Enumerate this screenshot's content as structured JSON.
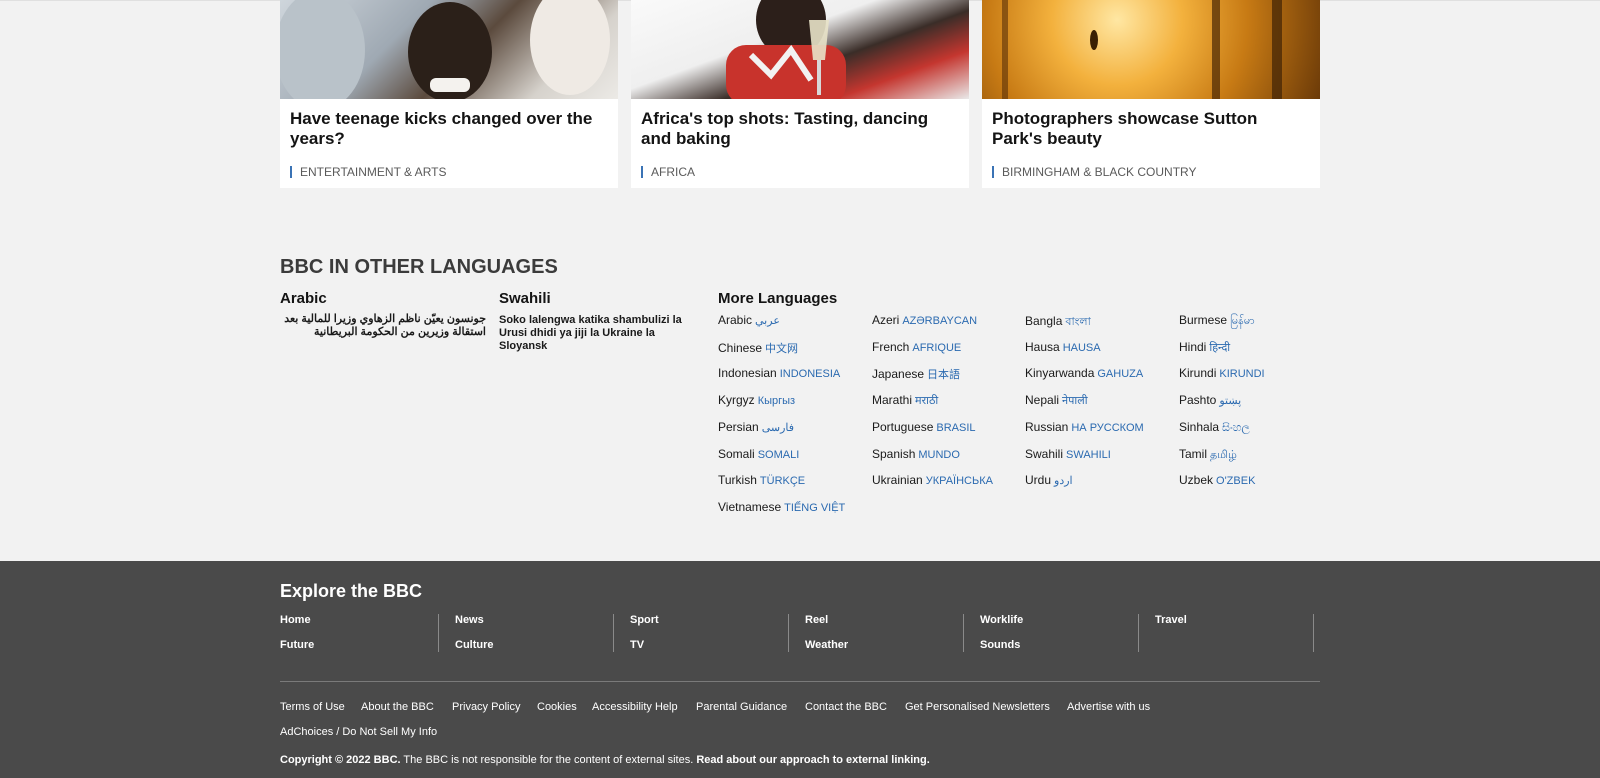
{
  "cards": [
    {
      "headline": "Have teenage kicks changed over the years?",
      "tag": "ENTERTAINMENT & ARTS"
    },
    {
      "headline": "Africa's top shots: Tasting, dancing and baking",
      "tag": "AFRICA"
    },
    {
      "headline": "Photographers showcase Sutton Park's beauty",
      "tag": "BIRMINGHAM & BLACK COUNTRY"
    }
  ],
  "languages": {
    "title": "BBC IN OTHER LANGUAGES",
    "arabic": {
      "heading": "Arabic",
      "story": "جونسون يعيّن ناظم الزهاوي وزيرا للمالية بعد استقالة وزيرين من الحكومة البريطانية"
    },
    "swahili": {
      "heading": "Swahili",
      "story": "Soko lalengwa katika shambulizi la Urusi dhidi ya jiji la Ukraine la Sloyansk"
    },
    "more_heading": "More Languages",
    "items": [
      {
        "name": "Arabic",
        "native": "عربي"
      },
      {
        "name": "Azeri",
        "native": "AZƏRBAYCAN"
      },
      {
        "name": "Bangla",
        "native": "বাংলা"
      },
      {
        "name": "Burmese",
        "native": "မြန်မာ"
      },
      {
        "name": "Chinese",
        "native": "中文网"
      },
      {
        "name": "French",
        "native": "AFRIQUE"
      },
      {
        "name": "Hausa",
        "native": "HAUSA"
      },
      {
        "name": "Hindi",
        "native": "हिन्दी"
      },
      {
        "name": "Indonesian",
        "native": "INDONESIA"
      },
      {
        "name": "Japanese",
        "native": "日本語"
      },
      {
        "name": "Kinyarwanda",
        "native": "GAHUZA"
      },
      {
        "name": "Kirundi",
        "native": "KIRUNDI"
      },
      {
        "name": "Kyrgyz",
        "native": "Кыргыз"
      },
      {
        "name": "Marathi",
        "native": "मराठी"
      },
      {
        "name": "Nepali",
        "native": "नेपाली"
      },
      {
        "name": "Pashto",
        "native": "پښتو"
      },
      {
        "name": "Persian",
        "native": "فارسی"
      },
      {
        "name": "Portuguese",
        "native": "BRASIL"
      },
      {
        "name": "Russian",
        "native": "НА РУССКОМ"
      },
      {
        "name": "Sinhala",
        "native": "සිංහල"
      },
      {
        "name": "Somali",
        "native": "SOMALI"
      },
      {
        "name": "Spanish",
        "native": "MUNDO"
      },
      {
        "name": "Swahili",
        "native": "SWAHILI"
      },
      {
        "name": "Tamil",
        "native": "தமிழ்"
      },
      {
        "name": "Turkish",
        "native": "TÜRKÇE"
      },
      {
        "name": "Ukrainian",
        "native": "УКРАЇНСЬКА"
      },
      {
        "name": "Urdu",
        "native": "اردو"
      },
      {
        "name": "Uzbek",
        "native": "O'ZBEK"
      },
      {
        "name": "Vietnamese",
        "native": "TIẾNG VIỆT"
      }
    ]
  },
  "footer": {
    "explore_title": "Explore the BBC",
    "nav": [
      [
        "Home",
        "Future"
      ],
      [
        "News",
        "Culture"
      ],
      [
        "Sport",
        "TV"
      ],
      [
        "Reel",
        "Weather"
      ],
      [
        "Worklife",
        "Sounds"
      ],
      [
        "Travel",
        ""
      ]
    ],
    "legal_links": [
      "Terms of Use",
      "About the BBC",
      "Privacy Policy",
      "Cookies",
      "Accessibility Help",
      "Parental Guidance",
      "Contact the BBC",
      "Get Personalised Newsletters",
      "Advertise with us",
      "AdChoices / Do Not Sell My Info"
    ],
    "copyright_bold": "Copyright © 2022 BBC.",
    "copyright_text": " The BBC is not responsible for the content of external sites. ",
    "copyright_link": "Read about our approach to external linking."
  }
}
